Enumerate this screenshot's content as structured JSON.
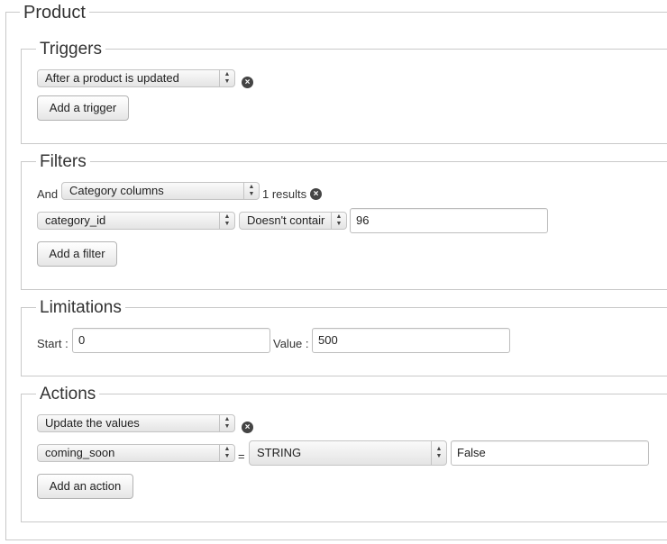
{
  "product": {
    "legend": "Product"
  },
  "triggers": {
    "legend": "Triggers",
    "select_value": "After a product is updated",
    "remove_icon": "close-icon",
    "add_label": "Add a trigger"
  },
  "filters": {
    "legend": "Filters",
    "and_label": "And",
    "table_select": "Category columns",
    "results_text": "1 results",
    "column_select": "category_id",
    "operator_select": "Doesn't contair",
    "value": "96",
    "add_label": "Add a filter"
  },
  "limitations": {
    "legend": "Limitations",
    "start_label": "Start :",
    "start_value": "0",
    "value_label": "Value :",
    "value_value": "500"
  },
  "actions": {
    "legend": "Actions",
    "select_value": "Update the values",
    "field_select": "coming_soon",
    "equals": "=",
    "type_select": "STRING",
    "value": "False",
    "add_label": "Add an action"
  }
}
